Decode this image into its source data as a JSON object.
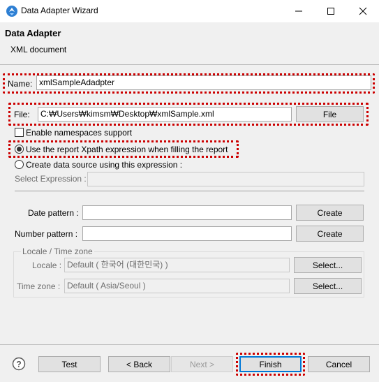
{
  "window": {
    "title": "Data Adapter Wizard"
  },
  "header": {
    "title": "Data Adapter",
    "description": "XML document"
  },
  "name_field": {
    "label": "Name:",
    "value": "xmlSampleAdadpter"
  },
  "file_field": {
    "label": "File:",
    "value": "C:₩Users₩kimsm₩Desktop₩xmlSample.xml",
    "button": "File"
  },
  "namespaces": {
    "label": "Enable namespaces support",
    "checked": false
  },
  "radio_report": {
    "label": "Use the report Xpath expression when filling the report",
    "selected": true
  },
  "radio_create": {
    "label": "Create data source using this expression :",
    "selected": false
  },
  "select_expression": {
    "label": "Select Expression :",
    "value": ""
  },
  "date_pattern": {
    "label": "Date pattern :",
    "value": "",
    "button": "Create"
  },
  "number_pattern": {
    "label": "Number pattern :",
    "value": "",
    "button": "Create"
  },
  "locale_group": {
    "title": "Locale / Time zone",
    "locale_label": "Locale :",
    "locale_value": "Default ( 한국어 (대한민국) )",
    "locale_button": "Select...",
    "timezone_label": "Time zone :",
    "timezone_value": "Default ( Asia/Seoul )",
    "timezone_button": "Select..."
  },
  "footer": {
    "test": "Test",
    "back": "< Back",
    "next": "Next >",
    "finish": "Finish",
    "cancel": "Cancel"
  },
  "colors": {
    "highlight": "#cc0000",
    "accent": "#0078d7"
  }
}
